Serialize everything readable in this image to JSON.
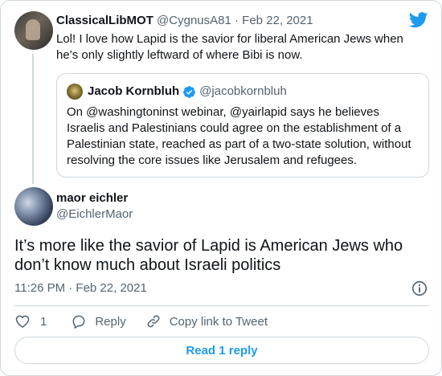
{
  "colors": {
    "accent": "#1d9bf0",
    "text": "#0f1419",
    "muted": "#536471",
    "border": "#cfd9de"
  },
  "parent_tweet": {
    "name": "ClassicalLibMOT",
    "handle": "@CygnusA81",
    "separator": "·",
    "date": "Feb 22, 2021",
    "text": "Lol! I love how Lapid is the savior for liberal American Jews when he’s only slightly leftward of where Bibi is now."
  },
  "quoted_tweet": {
    "name": "Jacob Kornbluh",
    "handle": "@jacobkornbluh",
    "verified_icon": "verified-badge-icon",
    "text": "On @washingtoninst webinar, @yairlapid says he believes Israelis and Palestinians could agree on the establishment of a Palestinian state, reached as part of a two-state solution, without resolving the core issues like Jerusalem and refugees."
  },
  "main_tweet": {
    "name": "maor eichler",
    "handle": "@EichlerMaor",
    "text": "It’s more like the savior of Lapid is American Jews who don’t know much about Israeli politics",
    "timestamp": "11:26 PM · Feb 22, 2021"
  },
  "actions": {
    "like_count": "1",
    "reply_label": "Reply",
    "copy_label": "Copy link to Tweet"
  },
  "read_replies_label": "Read 1 reply",
  "icons": [
    "twitter-bird-icon",
    "verified-badge-icon",
    "info-icon",
    "heart-icon",
    "reply-bubble-icon",
    "link-icon"
  ]
}
